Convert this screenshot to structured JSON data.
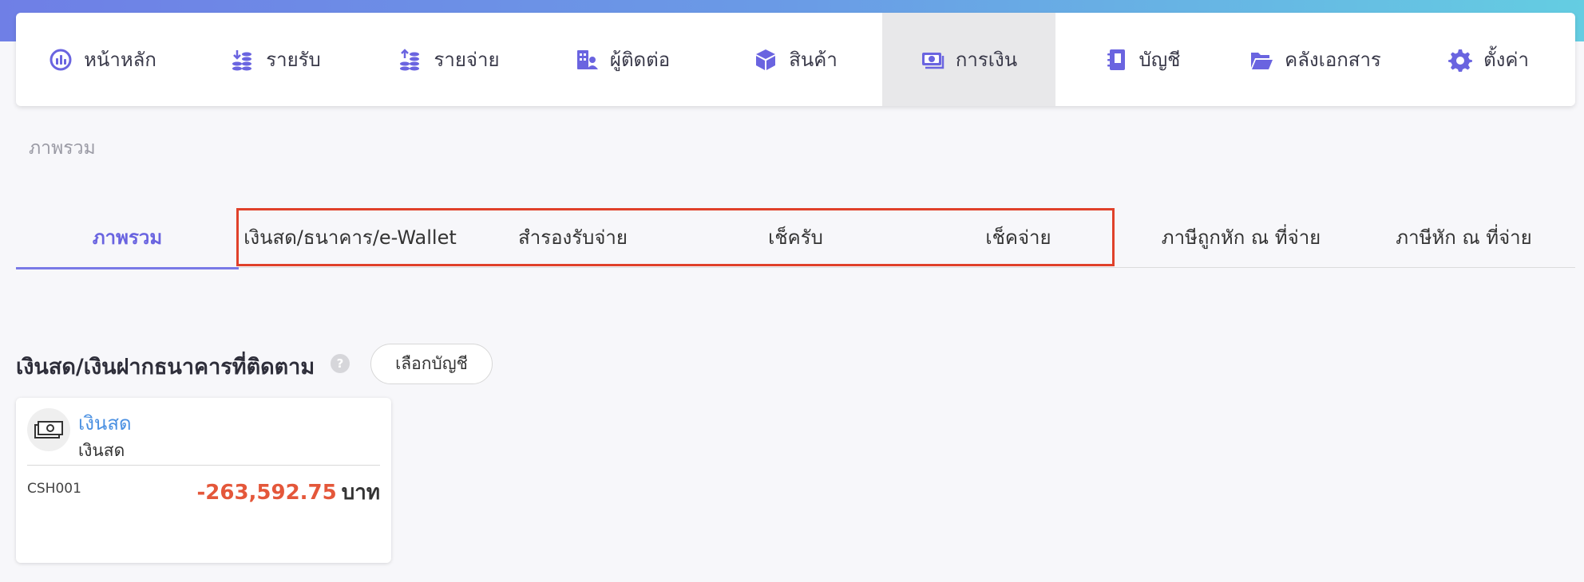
{
  "nav": {
    "items": [
      {
        "label": "หน้าหลัก",
        "icon": "dashboard-icon"
      },
      {
        "label": "รายรับ",
        "icon": "income-icon"
      },
      {
        "label": "รายจ่าย",
        "icon": "expense-icon"
      },
      {
        "label": "ผู้ติดต่อ",
        "icon": "contacts-icon"
      },
      {
        "label": "สินค้า",
        "icon": "product-box-icon"
      },
      {
        "label": "การเงิน",
        "icon": "money-icon"
      },
      {
        "label": "บัญชี",
        "icon": "ledger-book-icon"
      },
      {
        "label": "คลังเอกสาร",
        "icon": "folder-icon"
      },
      {
        "label": "ตั้งค่า",
        "icon": "gear-icon"
      }
    ],
    "active_index": 5
  },
  "breadcrumb": "ภาพรวม",
  "tabs": {
    "items": [
      "ภาพรวม",
      "เงินสด/ธนาคาร/e-Wallet",
      "สำรองรับจ่าย",
      "เช็ครับ",
      "เช็คจ่าย",
      "ภาษีถูกหัก ณ ที่จ่าย",
      "ภาษีหัก ณ ที่จ่าย"
    ],
    "active_index": 0
  },
  "section": {
    "title": "เงินสด/เงินฝากธนาคารที่ติดตาม",
    "help": "?",
    "select_button": "เลือกบัญชี"
  },
  "account_card": {
    "name": "เงินสด",
    "type": "เงินสด",
    "code": "CSH001",
    "amount": "-263,592.75",
    "currency": "บาท"
  },
  "colors": {
    "accent": "#6a64e0",
    "link": "#4a90e2",
    "negative": "#e4573a",
    "highlight": "#e0412a"
  }
}
